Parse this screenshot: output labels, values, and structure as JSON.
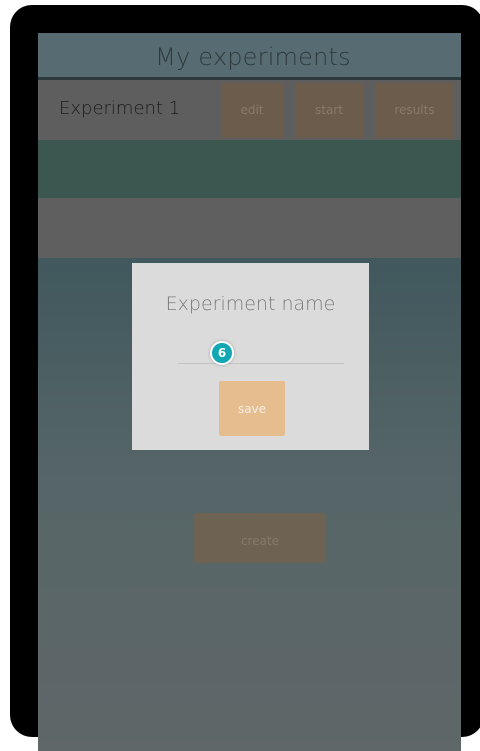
{
  "header": {
    "title": "My experiments"
  },
  "experiments": [
    {
      "name": "Experiment 1",
      "edit_label": "edit",
      "start_label": "start",
      "results_label": "results"
    }
  ],
  "create_label": "create",
  "dialog": {
    "title": "Experiment name",
    "input_value": "",
    "save_label": "save"
  },
  "marker": {
    "number": "6"
  },
  "colors": {
    "accent_button": "#e5bd8f",
    "marker": "#11a7b3",
    "dialog_bg": "#dbdbdb"
  }
}
